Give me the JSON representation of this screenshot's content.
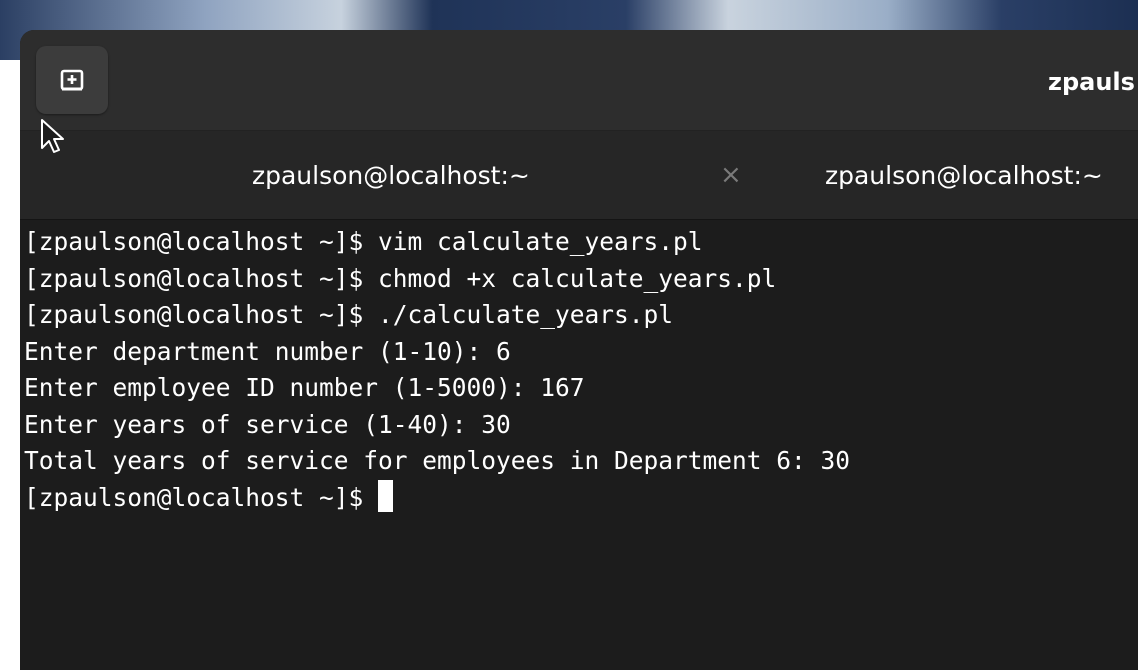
{
  "window": {
    "title": "zpauls"
  },
  "headerbar": {
    "new_tab_icon": "new-tab-icon"
  },
  "tabs": [
    {
      "label": "zpaulson@localhost:~",
      "close": "×"
    },
    {
      "label": "zpaulson@localhost:~"
    }
  ],
  "terminal": {
    "lines": [
      "[zpaulson@localhost ~]$ vim calculate_years.pl",
      "[zpaulson@localhost ~]$ chmod +x calculate_years.pl",
      "[zpaulson@localhost ~]$ ./calculate_years.pl",
      "Enter department number (1-10): 6",
      "Enter employee ID number (1-5000): 167",
      "Enter years of service (1-40): 30",
      "Total years of service for employees in Department 6: 30"
    ],
    "prompt": "[zpaulson@localhost ~]$ "
  },
  "colors": {
    "terminal_bg": "#1c1c1c",
    "headerbar_bg": "#2d2d2d",
    "tabbar_bg": "#262626",
    "text": "#ffffff"
  }
}
